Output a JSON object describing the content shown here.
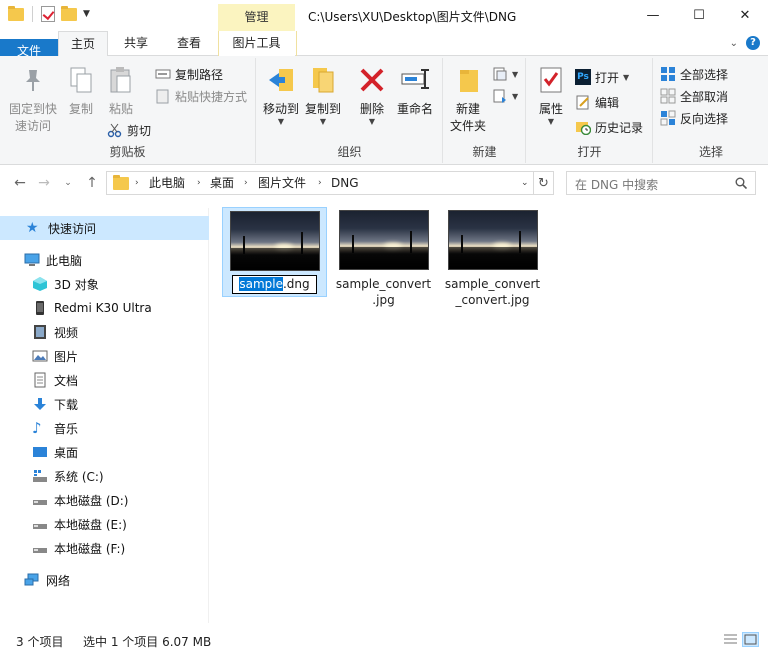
{
  "titlebar": {
    "manage_tab": "管理",
    "path": "C:\\Users\\XU\\Desktop\\图片文件\\DNG",
    "minimize": "—",
    "maximize": "☐",
    "close": "✕"
  },
  "tabs": {
    "file": "文件",
    "home": "主页",
    "share": "共享",
    "view": "查看",
    "picture_tools": "图片工具"
  },
  "ribbon": {
    "clipboard": {
      "label": "剪贴板",
      "pin_line1": "固定到快",
      "pin_line2": "速访问",
      "copy": "复制",
      "paste": "粘贴",
      "copy_path": "复制路径",
      "paste_shortcut": "粘贴快捷方式",
      "cut": "剪切"
    },
    "organize": {
      "label": "组织",
      "move_to": "移动到",
      "copy_to": "复制到",
      "delete": "删除",
      "rename": "重命名"
    },
    "new": {
      "label": "新建",
      "new_folder_line1": "新建",
      "new_folder_line2": "文件夹"
    },
    "open": {
      "label": "打开",
      "properties": "属性",
      "open": "打开",
      "edit": "编辑",
      "history": "历史记录"
    },
    "select": {
      "label": "选择",
      "select_all": "全部选择",
      "select_none": "全部取消",
      "invert": "反向选择"
    }
  },
  "address": {
    "crumbs": [
      "此电脑",
      "桌面",
      "图片文件",
      "DNG"
    ],
    "search_placeholder": "在 DNG 中搜索"
  },
  "nav": {
    "quick_access": "快速访问",
    "this_pc": "此电脑",
    "objects3d": "3D 对象",
    "phone": "Redmi K30 Ultra",
    "videos": "视频",
    "pictures": "图片",
    "documents": "文档",
    "downloads": "下载",
    "music": "音乐",
    "desktop": "桌面",
    "system_c": "系统 (C:)",
    "disk_d": "本地磁盘 (D:)",
    "disk_e": "本地磁盘 (E:)",
    "disk_f": "本地磁盘 (F:)",
    "network": "网络"
  },
  "files": [
    {
      "name_selected": "sample",
      "name_rest": ".dng"
    },
    {
      "name_line1": "sample_convert",
      "name_line2": ".jpg"
    },
    {
      "name_line1": "sample_convert",
      "name_line2": "_convert.jpg"
    }
  ],
  "status": {
    "count": "3 个项目",
    "selection": "选中 1 个项目  6.07 MB"
  },
  "colors": {
    "accent": "#1979ca",
    "selected_bg": "#cce8ff",
    "manage_tab_bg": "#fbf4c0"
  }
}
